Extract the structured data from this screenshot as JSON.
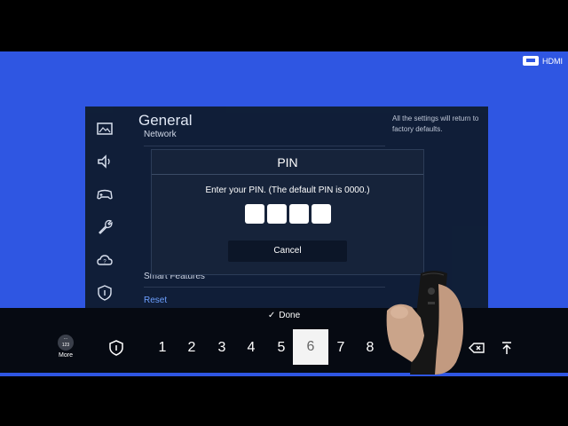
{
  "tv_input": {
    "label": "HDMI"
  },
  "menu": {
    "title": "General",
    "sidebar_icons": [
      "picture-icon",
      "sound-icon",
      "game-controller-icon",
      "wrench-icon",
      "support-cloud-icon",
      "privacy-shield-icon"
    ],
    "items": [
      {
        "label": "Network",
        "selected": false
      },
      {
        "label": "Smart Features",
        "selected": false
      },
      {
        "label": "Reset",
        "selected": true
      }
    ],
    "help_text": "All the settings will return to factory defaults."
  },
  "pin_dialog": {
    "title": "PIN",
    "prompt": "Enter your PIN. (The default PIN is 0000.)",
    "cancel_label": "Cancel"
  },
  "keyboard": {
    "done_label": "Done",
    "more": {
      "badge": "123",
      "label": "More"
    },
    "keys": [
      "1",
      "2",
      "3",
      "4",
      "5",
      "6",
      "7",
      "8"
    ],
    "active_key": "6"
  },
  "colors": {
    "screen_bg": "#2f56e2",
    "menu_bg": "#0f1d33",
    "selected": "#6fa2ff"
  }
}
